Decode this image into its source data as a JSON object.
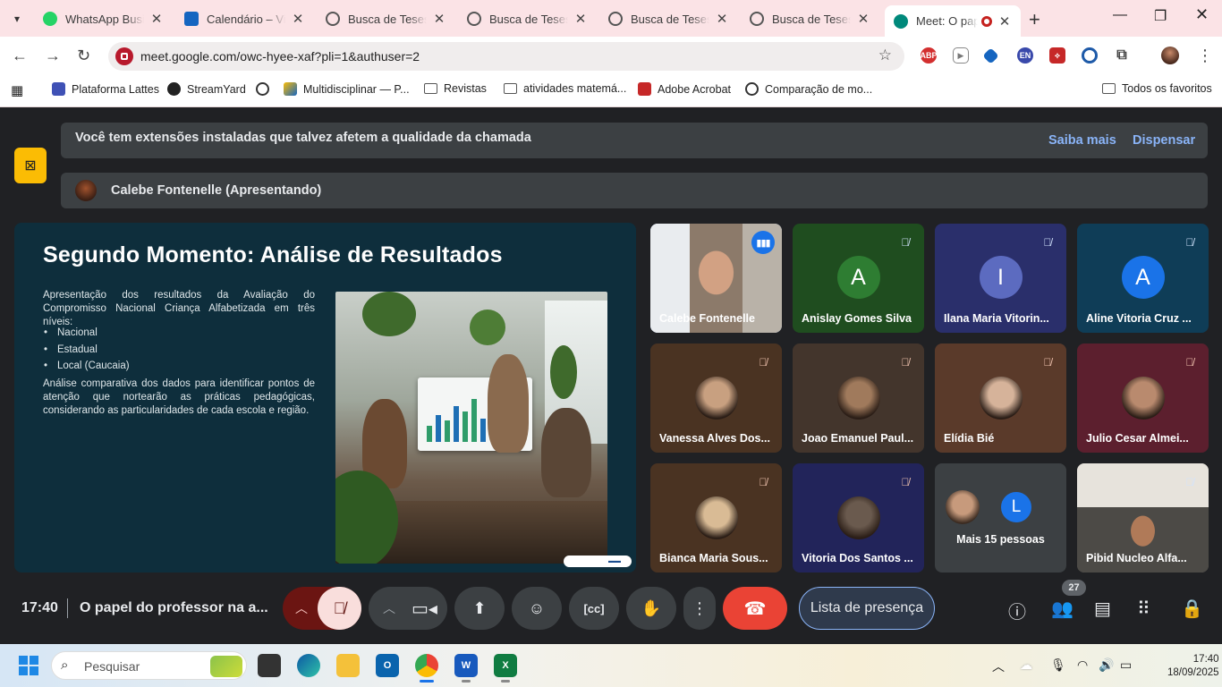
{
  "browser": {
    "tabs": [
      {
        "title": "WhatsApp Business",
        "icon": "whatsapp-icon",
        "color": "#25d366"
      },
      {
        "title": "Calendário – Vida",
        "icon": "calendar-icon",
        "color": "#1565c0"
      },
      {
        "title": "Busca de Teses e Dissertações",
        "icon": "globe-icon",
        "color": "#555555"
      },
      {
        "title": "Busca de Teses e Dissertações",
        "icon": "globe-icon",
        "color": "#555555"
      },
      {
        "title": "Busca de Teses e Dissertações",
        "icon": "globe-icon",
        "color": "#555555"
      },
      {
        "title": "Busca de Teses e Dissertações",
        "icon": "globe-icon",
        "color": "#555555"
      },
      {
        "title": "Meet: O papel do professor",
        "icon": "meet-icon",
        "color": "#00897b"
      }
    ],
    "url": "meet.google.com/owc-hyee-xaf?pli=1&authuser=2",
    "bookmarks": [
      {
        "label": "Plataforma Lattes"
      },
      {
        "label": "StreamYard"
      },
      {
        "label": ""
      },
      {
        "label": "Multidisciplinar — P..."
      },
      {
        "label": "Revistas"
      },
      {
        "label": "atividades matemá..."
      },
      {
        "label": "Adobe Acrobat"
      },
      {
        "label": "Comparação de mo..."
      }
    ],
    "all_bookmarks": "Todos os favoritos",
    "extensions": [
      "ABP",
      "EN"
    ]
  },
  "meet": {
    "banner_msg": "Você tem extensões instaladas que talvez afetem a qualidade da chamada",
    "learn_more": "Saiba mais",
    "dismiss": "Dispensar",
    "presenting": "Calebe Fontenelle (Apresentando)",
    "slide": {
      "title": "Segundo Momento: Análise de Resultados",
      "intro": "Apresentação dos resultados da Avaliação do Compromisso Nacional Criança Alfabetizada em três níveis:",
      "bullets": [
        "Nacional",
        "Estadual",
        "Local (Caucaia)"
      ],
      "body": "Análise comparativa dos dados para identificar pontos de atenção que nortearão as práticas pedagógicas, considerando as particularidades de cada escola e região."
    },
    "participants": [
      {
        "name": "Calebe Fontenelle",
        "type": "video",
        "bg": "#6d5a4c"
      },
      {
        "name": "Anislay Gomes Silva",
        "type": "letter",
        "letter": "A",
        "bg": "#1f4d1f",
        "circle": "#2e7d32"
      },
      {
        "name": "Ilana Maria Vitorin...",
        "type": "letter",
        "letter": "I",
        "bg": "#2a2f6b",
        "circle": "#5c6bc0"
      },
      {
        "name": "Aline Vitoria Cruz ...",
        "type": "letter",
        "letter": "A",
        "bg": "#0f3d57",
        "circle": "#1a73e8"
      },
      {
        "name": "Vanessa Alves Dos...",
        "type": "photo",
        "bg": "#4a3322",
        "face": "#c8a080"
      },
      {
        "name": "Joao Emanuel Paul...",
        "type": "photo",
        "bg": "#43352c",
        "face": "#a07a5c"
      },
      {
        "name": "Elídia Bié",
        "type": "photo",
        "bg": "#5a3a2a",
        "face": "#d6b39a"
      },
      {
        "name": "Julio Cesar Almei...",
        "type": "photo",
        "bg": "#5c1f2e",
        "face": "#b98a6e"
      },
      {
        "name": "Bianca Maria Sous...",
        "type": "photo",
        "bg": "#4a3322",
        "face": "#d9bb95"
      },
      {
        "name": "Vitoria Dos Santos ...",
        "type": "photo",
        "bg": "#22245a",
        "face": "#6a5a4e"
      },
      {
        "name": "Mais 15 pessoas",
        "type": "more",
        "bg": "#3c4043",
        "letter": "L"
      },
      {
        "name": "Pibid Nucleo Alfa...",
        "type": "video",
        "bg": "#6b6660"
      }
    ],
    "time": "17:40",
    "meeting_title": "O papel do professor na a...",
    "attendance": "Lista de presença",
    "people_count": "27"
  },
  "taskbar": {
    "search_placeholder": "Pesquisar",
    "time": "17:40",
    "date": "18/09/2025"
  }
}
